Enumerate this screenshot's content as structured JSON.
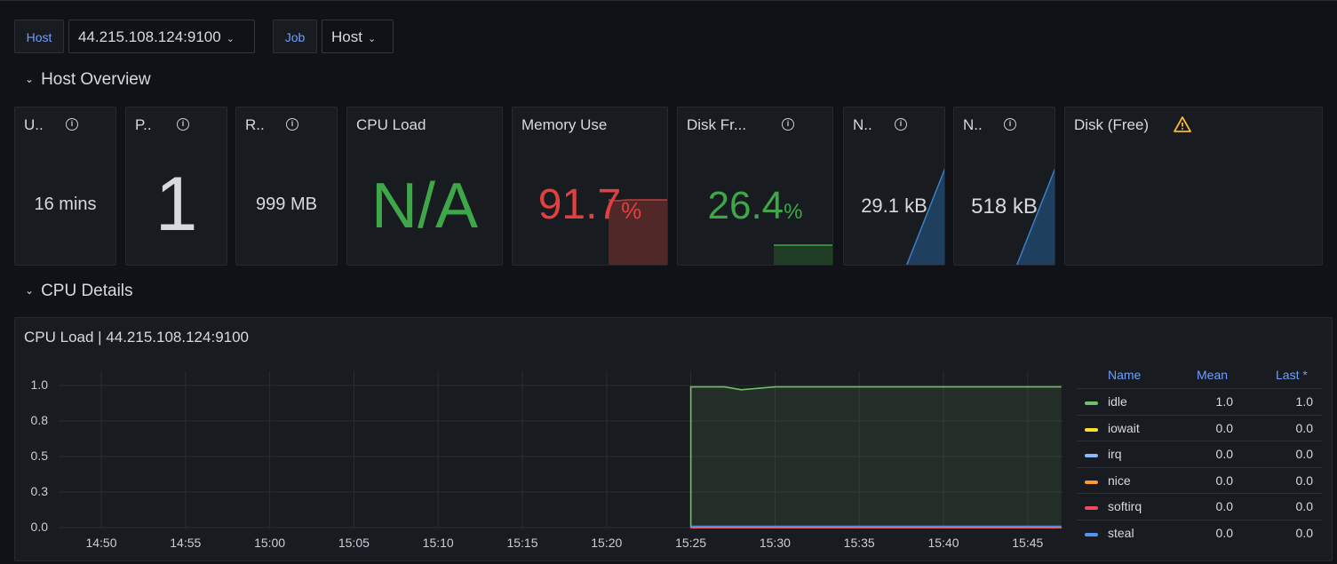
{
  "variables": {
    "host_label": "Host",
    "host_value": "44.215.108.124:9100",
    "job_label": "Job",
    "job_value": "Host"
  },
  "rows": {
    "host_overview": "Host Overview",
    "cpu_details": "CPU Details"
  },
  "stats": {
    "uptime": {
      "title": "U..",
      "value": "16 mins"
    },
    "processors": {
      "title": "P..",
      "value": "1"
    },
    "ram": {
      "title": "R..",
      "value": "999 MB"
    },
    "cpu_load": {
      "title": "CPU Load",
      "value": "N/A"
    },
    "memory_use": {
      "title": "Memory Use",
      "value": "91.7",
      "unit": "%",
      "color": "#e0403f"
    },
    "disk_free": {
      "title": "Disk Fr...",
      "value": "26.4",
      "unit": "%",
      "color": "#3ea748"
    },
    "net1": {
      "title": "N..",
      "value": "29.1 kB"
    },
    "net2": {
      "title": "N..",
      "value": "518 kB"
    },
    "disk_free_panel": {
      "title": "Disk (Free)"
    }
  },
  "cpu_panel": {
    "title": "CPU Load | 44.215.108.124:9100",
    "legend_headers": {
      "name": "Name",
      "mean": "Mean",
      "last": "Last *"
    }
  },
  "chart_data": {
    "type": "line",
    "title": "CPU Load | 44.215.108.124:9100",
    "xlabel": "",
    "ylabel": "",
    "x_ticks": [
      "14:50",
      "14:55",
      "15:00",
      "15:05",
      "15:10",
      "15:15",
      "15:20",
      "15:25",
      "15:30",
      "15:35",
      "15:40",
      "15:45"
    ],
    "y_ticks": [
      "0.0",
      "0.3",
      "0.5",
      "0.8",
      "1.0"
    ],
    "ylim": [
      0,
      1.0
    ],
    "grid": true,
    "legend_placement": "right",
    "series": [
      {
        "name": "idle",
        "color": "#73bf69",
        "mean": "1.0",
        "last": "1.0",
        "x": [
          "15:25",
          "15:27",
          "15:28",
          "15:30",
          "15:35",
          "15:40",
          "15:45",
          "15:47"
        ],
        "values": [
          0.99,
          0.99,
          0.97,
          0.99,
          0.99,
          0.99,
          0.99,
          0.99
        ]
      },
      {
        "name": "iowait",
        "color": "#fade2a",
        "mean": "0.0",
        "last": "0.0",
        "x": [
          "15:25",
          "15:30",
          "15:35",
          "15:40",
          "15:45",
          "15:47"
        ],
        "values": [
          0.0,
          0.0,
          0.0,
          0.0,
          0.0,
          0.0
        ]
      },
      {
        "name": "irq",
        "color": "#8ab8ff",
        "mean": "0.0",
        "last": "0.0",
        "x": [
          "15:25",
          "15:30",
          "15:35",
          "15:40",
          "15:45",
          "15:47"
        ],
        "values": [
          0.0,
          0.0,
          0.0,
          0.0,
          0.0,
          0.0
        ]
      },
      {
        "name": "nice",
        "color": "#ff9830",
        "mean": "0.0",
        "last": "0.0",
        "x": [
          "15:25",
          "15:30",
          "15:35",
          "15:40",
          "15:45",
          "15:47"
        ],
        "values": [
          0.0,
          0.0,
          0.0,
          0.0,
          0.0,
          0.0
        ]
      },
      {
        "name": "softirq",
        "color": "#f2495c",
        "mean": "0.0",
        "last": "0.0",
        "x": [
          "15:25",
          "15:30",
          "15:35",
          "15:40",
          "15:45",
          "15:47"
        ],
        "values": [
          0.0,
          0.0,
          0.0,
          0.0,
          0.0,
          0.0
        ]
      },
      {
        "name": "steal",
        "color": "#5794f2",
        "mean": "0.0",
        "last": "0.0",
        "x": [
          "15:25",
          "15:30",
          "15:35",
          "15:40",
          "15:45",
          "15:47"
        ],
        "values": [
          0.01,
          0.01,
          0.01,
          0.01,
          0.01,
          0.01
        ]
      }
    ]
  }
}
